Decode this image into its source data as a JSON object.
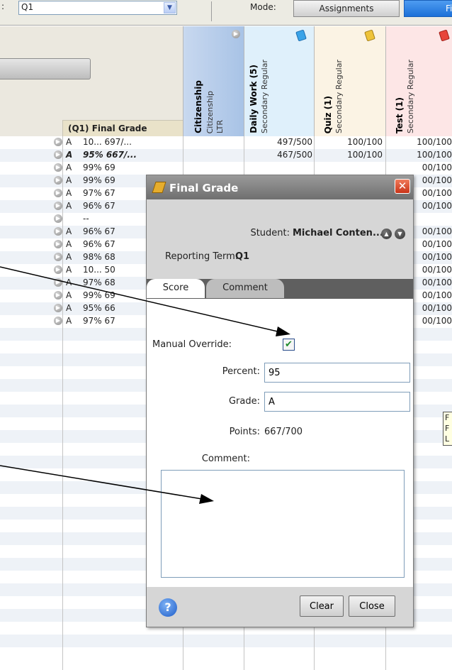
{
  "toolbar": {
    "term_prefix": ":",
    "term_selected": "Q1",
    "mode_label": "Mode:",
    "mode_assignments": "Assignments",
    "mode_final": "Final"
  },
  "columns": {
    "final_grade_header": "(Q1) Final Grade",
    "citizenship": {
      "title": "Citizenship",
      "sub1": "Citizenship",
      "sub2": "LTR"
    },
    "daily_work": {
      "title": "Daily Work (5)",
      "sub": "Secondary Regular"
    },
    "quiz": {
      "title": "Quiz (1)",
      "sub": "Secondary Regular"
    },
    "test": {
      "title": "Test (1)",
      "sub": "Secondary Regular"
    }
  },
  "rows": [
    {
      "grade": "A",
      "pct": "10...  697/...",
      "dw": "497/500",
      "qz": "100/100",
      "ts": "100/100",
      "bold": false
    },
    {
      "grade": "A",
      "pct": "95%  667/...",
      "dw": "467/500",
      "qz": "100/100",
      "ts": "100/100",
      "bold": true
    },
    {
      "grade": "A",
      "pct": "99%  69",
      "dw": "",
      "qz": "",
      "ts": "00/100",
      "bold": false
    },
    {
      "grade": "A",
      "pct": "99%  69",
      "dw": "",
      "qz": "",
      "ts": "00/100",
      "bold": false
    },
    {
      "grade": "A",
      "pct": "97%  67",
      "dw": "",
      "qz": "",
      "ts": "00/100",
      "bold": false
    },
    {
      "grade": "A",
      "pct": "96%  67",
      "dw": "",
      "qz": "",
      "ts": "00/100",
      "bold": false
    },
    {
      "grade": "",
      "pct": "     --",
      "dw": "",
      "qz": "",
      "ts": "",
      "bold": false
    },
    {
      "grade": "A",
      "pct": "96%  67",
      "dw": "",
      "qz": "",
      "ts": "00/100",
      "bold": false
    },
    {
      "grade": "A",
      "pct": "96%  67",
      "dw": "",
      "qz": "",
      "ts": "00/100",
      "bold": false
    },
    {
      "grade": "A",
      "pct": "98%  68",
      "dw": "",
      "qz": "",
      "ts": "00/100",
      "bold": false
    },
    {
      "grade": "A",
      "pct": "10...  50",
      "dw": "",
      "qz": "",
      "ts": "00/100",
      "bold": false
    },
    {
      "grade": "A",
      "pct": "97%  68",
      "dw": "",
      "qz": "",
      "ts": "00/100",
      "bold": false
    },
    {
      "grade": "A",
      "pct": "99%  69",
      "dw": "",
      "qz": "",
      "ts": "00/100",
      "bold": false
    },
    {
      "grade": "A",
      "pct": "95%  66",
      "dw": "",
      "qz": "",
      "ts": "00/100",
      "bold": false
    },
    {
      "grade": "A",
      "pct": "97%  67",
      "dw": "",
      "qz": "",
      "ts": "00/100",
      "bold": false
    }
  ],
  "tooltip": {
    "line1": "F",
    "line2": "F",
    "line3": "L"
  },
  "dialog": {
    "title": "Final Grade",
    "close_glyph": "✕",
    "student_label": "Student:",
    "student_name": "Michael Conten...",
    "term_label": "Reporting Term:",
    "term_value": "Q1",
    "tab_score": "Score",
    "tab_comment": "Comment",
    "override_label": "Manual Override:",
    "percent_label": "Percent:",
    "percent_value": "95",
    "grade_label": "Grade:",
    "grade_value": "A",
    "points_label": "Points:",
    "points_value": "667/700",
    "comment_label": "Comment:",
    "comment_value": "",
    "help_glyph": "?",
    "clear_label": "Clear",
    "close_label": "Close"
  },
  "colors": {
    "citizenship_header": "#b8cdea",
    "daily_work_header": "#dff0fb",
    "quiz_header": "#fbf3e4",
    "test_header": "#fde6e6",
    "final_mode_button": "#2b7fe0"
  }
}
